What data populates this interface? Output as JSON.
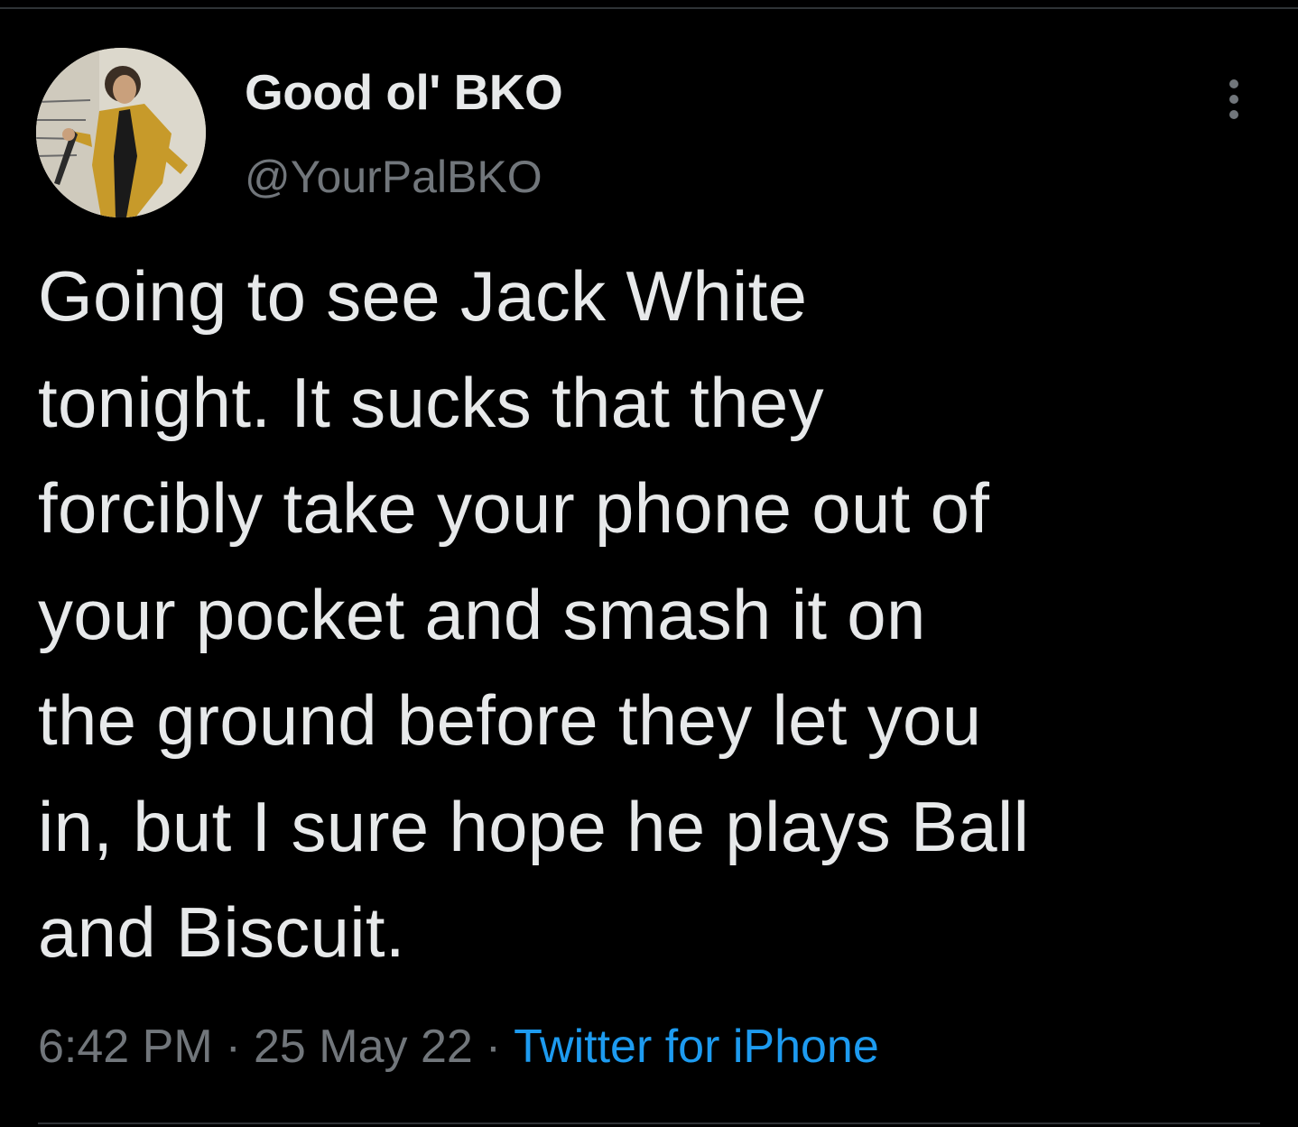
{
  "tweet": {
    "display_name": "Good ol' BKO",
    "handle": "@YourPalBKO",
    "text_lines": [
      "Going to see Jack White",
      "tonight. It sucks that they",
      "forcibly take your phone out of",
      "your pocket and smash it on",
      "the ground before they let you",
      "in, but I sure hope he plays Ball",
      "and Biscuit."
    ],
    "time": "6:42 PM",
    "separator": "·",
    "date": "25 May 22",
    "source": "Twitter for iPhone",
    "more_icon": "more-vertical-icon"
  },
  "colors": {
    "background": "#000000",
    "primary_text": "#e7e9ea",
    "secondary_text": "#71767b",
    "link": "#1d9bf0",
    "divider": "#2f3336"
  }
}
